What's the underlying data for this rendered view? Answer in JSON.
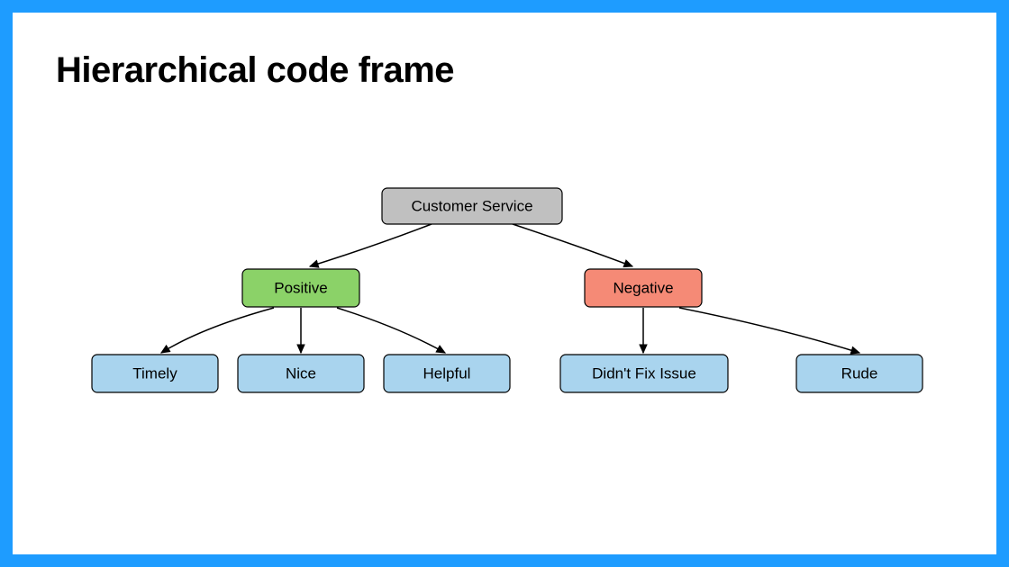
{
  "title": "Hierarchical code frame",
  "colors": {
    "root": "#c0c0c0",
    "positive": "#8bd268",
    "negative": "#f58a76",
    "leaf": "#a9d4ee",
    "border": "#1e9cff"
  },
  "nodes": {
    "root": {
      "label": "Customer Service"
    },
    "positive": {
      "label": "Positive"
    },
    "negative": {
      "label": "Negative"
    },
    "timely": {
      "label": "Timely"
    },
    "nice": {
      "label": "Nice"
    },
    "helpful": {
      "label": "Helpful"
    },
    "didntfix": {
      "label": "Didn't Fix Issue"
    },
    "rude": {
      "label": "Rude"
    }
  },
  "chart_data": {
    "type": "tree",
    "root": "Customer Service",
    "children": [
      {
        "label": "Positive",
        "children": [
          "Timely",
          "Nice",
          "Helpful"
        ]
      },
      {
        "label": "Negative",
        "children": [
          "Didn't Fix Issue",
          "Rude"
        ]
      }
    ]
  }
}
